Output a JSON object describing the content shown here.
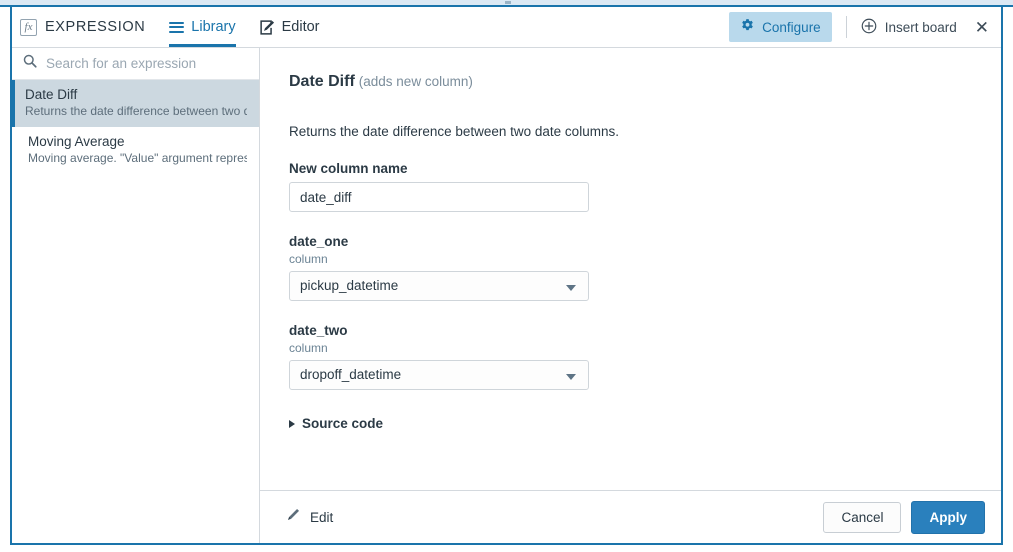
{
  "header": {
    "brand": "EXPRESSION",
    "brand_icon": "fx-icon",
    "tabs": [
      {
        "label": "Library",
        "icon": "hamburger-icon",
        "active": true
      },
      {
        "label": "Editor",
        "icon": "pencil-square-icon",
        "active": false
      }
    ],
    "configure_label": "Configure",
    "configure_icon": "gear-icon",
    "insert_board_label": "Insert board",
    "insert_board_icon": "plus-circle-icon",
    "close_icon": "close-icon",
    "close_glyph": "✕",
    "accent_color": "#1a74ab",
    "configure_bg": "#b9d9ec"
  },
  "sidebar": {
    "search": {
      "placeholder": "Search for an expression",
      "icon": "search-icon",
      "value": ""
    },
    "items": [
      {
        "title": "Date Diff",
        "description": "Returns the date difference between two d...",
        "selected": true
      },
      {
        "title": "Moving Average",
        "description": "Moving average. \"Value\" argument represe...",
        "selected": false
      }
    ]
  },
  "main": {
    "title": "Date Diff",
    "title_suffix": "(adds new column)",
    "description": "Returns the date difference between two date columns.",
    "fields": [
      {
        "label": "New column name",
        "sublabel": "",
        "type": "text",
        "value": "date_diff"
      },
      {
        "label": "date_one",
        "sublabel": "column",
        "type": "select",
        "value": "pickup_datetime"
      },
      {
        "label": "date_two",
        "sublabel": "column",
        "type": "select",
        "value": "dropoff_datetime"
      }
    ],
    "source_code_label": "Source code",
    "source_code_icon": "triangle-right-icon",
    "source_code_expanded": false
  },
  "footer": {
    "edit_label": "Edit",
    "edit_icon": "pencil-icon",
    "cancel_label": "Cancel",
    "apply_label": "Apply",
    "apply_color": "#2a80bd"
  }
}
